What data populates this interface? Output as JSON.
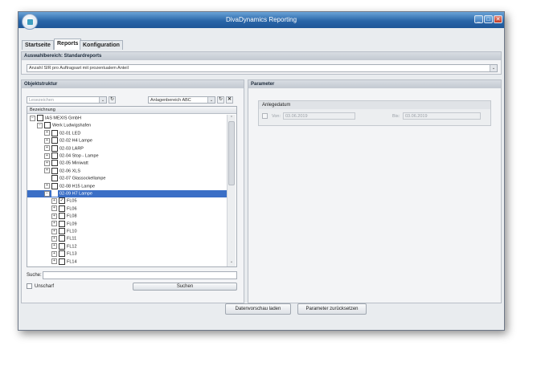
{
  "window": {
    "title": "DivaDynamics Reporting",
    "minimize_glyph": "_",
    "maximize_glyph": "□",
    "close_glyph": "✕"
  },
  "tabs": [
    {
      "label": "Startseite",
      "active": false
    },
    {
      "label": "Reports",
      "active": true
    },
    {
      "label": "Konfiguration",
      "active": false
    }
  ],
  "auswahlbereich": {
    "header": "Auswahlbereich: Standardreports",
    "selected_report": "Anzahl SIR pro Auftragsart mit prozentualem Anteil"
  },
  "objektstruktur": {
    "header": "Objektstruktur",
    "lesezeichen_placeholder": "Lesezeichen",
    "anlagenbereich_value": "Anlagenbereich ABC",
    "refresh_glyph": "↻",
    "clear_glyph": "✕",
    "column_header": "Bezeichnung",
    "tree": [
      {
        "label": "IAS MEXIS GmbH",
        "level": 0,
        "expander": "−",
        "checked": false,
        "selected": false
      },
      {
        "label": "Werk Ludwigshafen",
        "level": 1,
        "expander": "−",
        "checked": false,
        "selected": false
      },
      {
        "label": "02-01 LED",
        "level": 2,
        "expander": "+",
        "checked": false,
        "selected": false
      },
      {
        "label": "02-02 H4 Lampe",
        "level": 2,
        "expander": "+",
        "checked": false,
        "selected": false
      },
      {
        "label": "02-03 LARP",
        "level": 2,
        "expander": "+",
        "checked": false,
        "selected": false
      },
      {
        "label": "02-04 Stop - Lampe",
        "level": 2,
        "expander": "+",
        "checked": false,
        "selected": false
      },
      {
        "label": "02-05 Miniwatt",
        "level": 2,
        "expander": "+",
        "checked": false,
        "selected": false
      },
      {
        "label": "02-06 XLS",
        "level": 2,
        "expander": "+",
        "checked": false,
        "selected": false
      },
      {
        "label": "02-07 Glassockellampe",
        "level": 2,
        "expander": "",
        "checked": false,
        "selected": false
      },
      {
        "label": "02-08 H15 Lampe",
        "level": 2,
        "expander": "+",
        "checked": false,
        "selected": false
      },
      {
        "label": "02-09 H7 Lampe",
        "level": 2,
        "expander": "−",
        "checked": false,
        "selected": true
      },
      {
        "label": "FL05",
        "level": 3,
        "expander": "+",
        "checked": true,
        "selected": false
      },
      {
        "label": "FL06",
        "level": 3,
        "expander": "+",
        "checked": false,
        "selected": false
      },
      {
        "label": "FL08",
        "level": 3,
        "expander": "+",
        "checked": false,
        "selected": false
      },
      {
        "label": "FL09",
        "level": 3,
        "expander": "+",
        "checked": false,
        "selected": false
      },
      {
        "label": "FL10",
        "level": 3,
        "expander": "+",
        "checked": false,
        "selected": false
      },
      {
        "label": "FL11",
        "level": 3,
        "expander": "+",
        "checked": false,
        "selected": false
      },
      {
        "label": "FL12",
        "level": 3,
        "expander": "+",
        "checked": false,
        "selected": false
      },
      {
        "label": "FL13",
        "level": 3,
        "expander": "+",
        "checked": false,
        "selected": false
      },
      {
        "label": "FL14",
        "level": 3,
        "expander": "+",
        "checked": false,
        "selected": false
      }
    ],
    "search_label": "Suche:",
    "unscharf_label": "Unscharf",
    "search_button": "Suchen"
  },
  "parameter": {
    "header": "Parameter",
    "group_label": "Anlegedatum",
    "von_label": "Von:",
    "von_value": "03.06.2019",
    "bis_label": "Bis:",
    "bis_value": "03.06.2019"
  },
  "footer": {
    "preview_button": "Datenvorschau laden",
    "reset_button": "Parameter zurücksetzen"
  },
  "colors": {
    "titlebar": "#2a66a8",
    "selection": "#3b6fc6"
  }
}
